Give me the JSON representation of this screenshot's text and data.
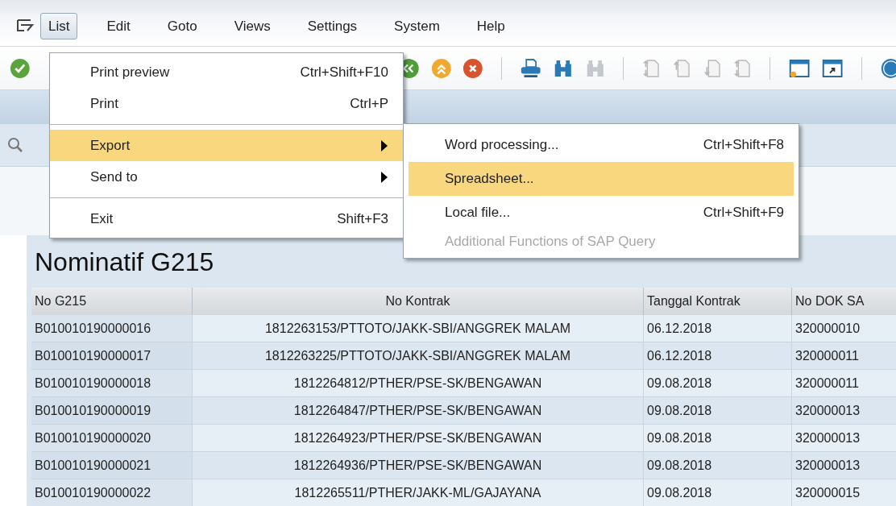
{
  "menubar": {
    "items": [
      {
        "label": "List",
        "selected": true
      },
      {
        "label": "Edit",
        "selected": false
      },
      {
        "label": "Goto",
        "selected": false
      },
      {
        "label": "Views",
        "selected": false
      },
      {
        "label": "Settings",
        "selected": false
      },
      {
        "label": "System",
        "selected": false
      },
      {
        "label": "Help",
        "selected": false
      }
    ]
  },
  "list_menu": {
    "items": [
      {
        "kind": "item",
        "label": "Print preview",
        "shortcut": "Ctrl+Shift+F10",
        "selected": false,
        "submenu": false
      },
      {
        "kind": "item",
        "label": "Print",
        "shortcut": "Ctrl+P",
        "selected": false,
        "submenu": false
      },
      {
        "kind": "separator"
      },
      {
        "kind": "item",
        "label": "Export",
        "selected": true,
        "submenu": true
      },
      {
        "kind": "item",
        "label": "Send to",
        "selected": false,
        "submenu": true
      },
      {
        "kind": "separator"
      },
      {
        "kind": "item",
        "label": "Exit",
        "shortcut": "Shift+F3",
        "selected": false,
        "submenu": false
      }
    ]
  },
  "export_submenu": {
    "items": [
      {
        "kind": "item",
        "label": "Word processing...",
        "shortcut": "Ctrl+Shift+F8",
        "selected": false,
        "disabled": false
      },
      {
        "kind": "item",
        "label": "Spreadsheet...",
        "selected": true,
        "disabled": false
      },
      {
        "kind": "item",
        "label": "Local file...",
        "shortcut": "Ctrl+Shift+F9",
        "selected": false,
        "disabled": false
      },
      {
        "kind": "item",
        "label": "Additional Functions of SAP Query",
        "selected": false,
        "disabled": true
      }
    ]
  },
  "report": {
    "title": "Nominatif G215",
    "columns": [
      "No G215",
      "No Kontrak",
      "Tanggal Kontrak",
      "No DOK SA"
    ],
    "rows": [
      [
        "B010010190000016",
        "1812263153/PTTOTO/JAKK-SBI/ANGGREK MALAM",
        "06.12.2018",
        "320000010"
      ],
      [
        "B010010190000017",
        "1812263225/PTTOTO/JAKK-SBI/ANGGREK MALAM",
        "06.12.2018",
        "320000011"
      ],
      [
        "B010010190000018",
        "1812264812/PTHER/PSE-SK/BENGAWAN",
        "09.08.2018",
        "320000011"
      ],
      [
        "B010010190000019",
        "1812264847/PTHER/PSE-SK/BENGAWAN",
        "09.08.2018",
        "320000013"
      ],
      [
        "B010010190000020",
        "1812264923/PTHER/PSE-SK/BENGAWAN",
        "09.08.2018",
        "320000013"
      ],
      [
        "B010010190000021",
        "1812264936/PTHER/PSE-SK/BENGAWAN",
        "09.08.2018",
        "320000013"
      ],
      [
        "B010010190000022",
        "1812265511/PTHER/JAKK-ML/GAJAYANA",
        "09.08.2018",
        "320000015"
      ]
    ]
  }
}
